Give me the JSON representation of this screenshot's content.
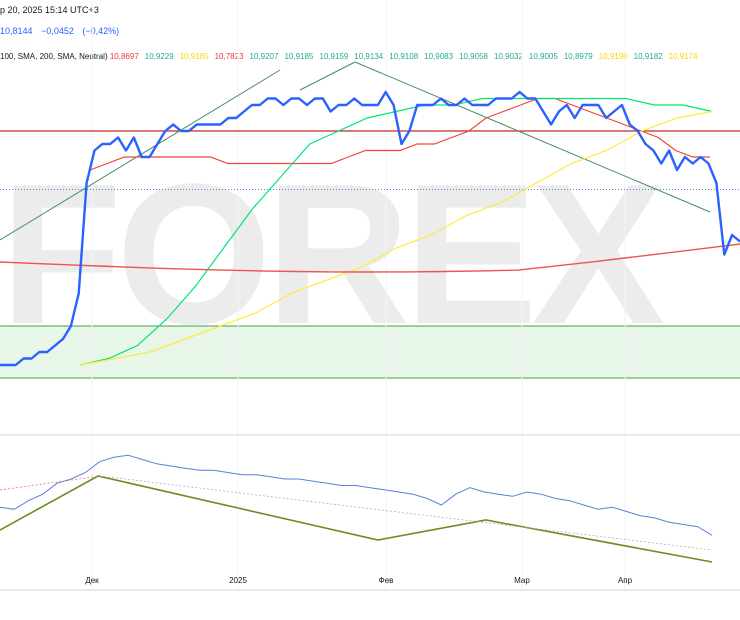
{
  "header": {
    "datetime": "р 20, 2025 15:14 UTC+3",
    "price": "10,8144",
    "change": "−0,0452",
    "change_pct": "(−0,42%)",
    "indicator_label": "100, SMA, 200, SMA, Neutral)",
    "ma_values": [
      {
        "text": "10,8697",
        "color": "#f23645"
      },
      {
        "text": "10,9229",
        "color": "#22ab94"
      },
      {
        "text": "10,9185",
        "color": "#ffd400"
      },
      {
        "text": "10,7823",
        "color": "#f23645"
      },
      {
        "text": "10,9207",
        "color": "#22ab94"
      },
      {
        "text": "10,9185",
        "color": "#22ab94"
      },
      {
        "text": "10,9159",
        "color": "#22ab94"
      },
      {
        "text": "10,9134",
        "color": "#22ab94"
      },
      {
        "text": "10,9108",
        "color": "#22ab94"
      },
      {
        "text": "10,9083",
        "color": "#22ab94"
      },
      {
        "text": "10,9058",
        "color": "#22ab94"
      },
      {
        "text": "10,9032",
        "color": "#22ab94"
      },
      {
        "text": "10,9005",
        "color": "#22ab94"
      },
      {
        "text": "10,8979",
        "color": "#22ab94"
      },
      {
        "text": "10,9190",
        "color": "#ffd400"
      },
      {
        "text": "10,9182",
        "color": "#22ab94"
      },
      {
        "text": "10,9174",
        "color": "#ffd400"
      }
    ]
  },
  "watermark": "FOREX",
  "chart_data": {
    "type": "line",
    "x_ticks": [
      "Дек",
      "2025",
      "Фев",
      "Мар",
      "Апр"
    ],
    "price_series": {
      "name": "price",
      "color": "#2962ff",
      "values": [
        10.55,
        10.55,
        10.55,
        10.56,
        10.56,
        10.57,
        10.57,
        10.58,
        10.59,
        10.61,
        10.66,
        10.83,
        10.88,
        10.89,
        10.89,
        10.9,
        10.88,
        10.9,
        10.87,
        10.87,
        10.89,
        10.91,
        10.92,
        10.91,
        10.91,
        10.92,
        10.92,
        10.92,
        10.92,
        10.93,
        10.93,
        10.94,
        10.95,
        10.95,
        10.96,
        10.96,
        10.95,
        10.96,
        10.96,
        10.95,
        10.96,
        10.96,
        10.94,
        10.95,
        10.95,
        10.96,
        10.95,
        10.95,
        10.95,
        10.97,
        10.95,
        10.89,
        10.91,
        10.95,
        10.95,
        10.95,
        10.96,
        10.95,
        10.95,
        10.96,
        10.95,
        10.95,
        10.95,
        10.96,
        10.96,
        10.96,
        10.97,
        10.96,
        10.96,
        10.94,
        10.92,
        10.94,
        10.95,
        10.93,
        10.95,
        10.95,
        10.95,
        10.93,
        10.94,
        10.95,
        10.92,
        10.91,
        10.89,
        10.88,
        10.86,
        10.88,
        10.85,
        10.87,
        10.86,
        10.87,
        10.86,
        10.83,
        10.72,
        10.75,
        10.74
      ]
    },
    "lines": [
      {
        "name": "MA fast",
        "color": "#f44336",
        "values": [
          10.85,
          10.86,
          10.87,
          10.87,
          10.87,
          10.87,
          10.87,
          10.87,
          10.86,
          10.86,
          10.86,
          10.86,
          10.86,
          10.86,
          10.86,
          10.87,
          10.88,
          10.88,
          10.88,
          10.89,
          10.89,
          10.9,
          10.91,
          10.93,
          10.94,
          10.95,
          10.96,
          10.96,
          10.95,
          10.94,
          10.93,
          10.92,
          10.91,
          10.9,
          10.88,
          10.87,
          10.87
        ]
      },
      {
        "name": "MA 100",
        "color": "#00e676",
        "values": [
          10.55,
          10.56,
          10.58,
          10.62,
          10.67,
          10.73,
          10.79,
          10.84,
          10.89,
          10.91,
          10.93,
          10.94,
          10.95,
          10.95,
          10.96,
          10.96,
          10.96,
          10.96,
          10.96,
          10.96,
          10.95,
          10.95,
          10.94
        ]
      },
      {
        "name": "MA 200",
        "color": "#ffeb3b",
        "values": [
          10.55,
          10.56,
          10.57,
          10.59,
          10.61,
          10.63,
          10.66,
          10.68,
          10.7,
          10.73,
          10.75,
          10.78,
          10.8,
          10.83,
          10.86,
          10.88,
          10.91,
          10.93,
          10.94
        ]
      }
    ],
    "levels": [
      10.91,
      10.82
    ],
    "zone": [
      10.61,
      10.53
    ],
    "oscillator": {
      "name": "RSI",
      "color": "#5b7fdb",
      "values": [
        49,
        48,
        52,
        55,
        60,
        62,
        65,
        70,
        72,
        73,
        71,
        69,
        68,
        67,
        66,
        66,
        65,
        64,
        64,
        63,
        62,
        62,
        61,
        60,
        59,
        59,
        58,
        57,
        56,
        55,
        53,
        50,
        55,
        58,
        56,
        55,
        54,
        56,
        55,
        53,
        52,
        50,
        48,
        49,
        47,
        45,
        44,
        42,
        41,
        40,
        36
      ]
    }
  }
}
